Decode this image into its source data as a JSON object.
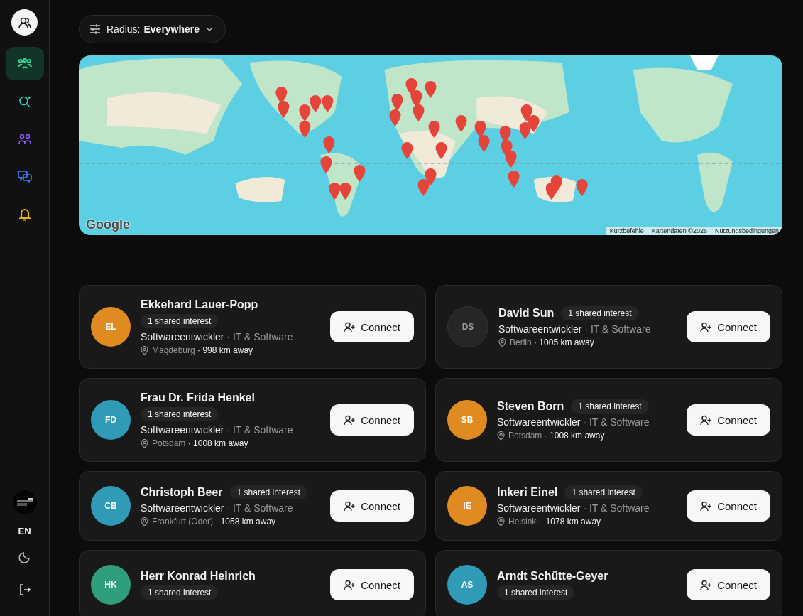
{
  "sidebar": {
    "items": [
      {
        "kind": "people",
        "selected": true,
        "color": "#34d399"
      },
      {
        "kind": "search",
        "selected": false,
        "color": "#2dd4bf"
      },
      {
        "kind": "group",
        "selected": false,
        "color": "#8b5cf6"
      },
      {
        "kind": "chat",
        "selected": false,
        "color": "#3b82f6"
      },
      {
        "kind": "bell",
        "selected": false,
        "color": "#eab308"
      }
    ],
    "language": "EN"
  },
  "filter": {
    "label": "Radius:",
    "value": "Everywhere"
  },
  "map": {
    "kind": "picture",
    "logo": "Google",
    "attribution": [
      "Kurzbefehle",
      "Kartendaten ©2026",
      "Nutzungsbedingungen"
    ]
  },
  "people": [
    {
      "initials": "EL",
      "color": "#e08b22",
      "name": "Ekkehard Lauer-Popp",
      "kind": "stacked",
      "badge": "1 shared interest",
      "role": "Softwareentwickler",
      "field": "· IT & Software",
      "city": "Magdeburg",
      "distance": "· 998 km away",
      "button": "Connect"
    },
    {
      "initials": "DS",
      "color": "#262626",
      "name": "David Sun",
      "kind": "inline",
      "badge": "1 shared interest",
      "role": "Softwareentwickler",
      "field": "· IT & Software",
      "city": "Berlin",
      "distance": "· 1005 km away",
      "button": "Connect"
    },
    {
      "initials": "FD",
      "color": "#2f9bb7",
      "name": "Frau Dr. Frida Henkel",
      "kind": "stacked",
      "badge": "1 shared interest",
      "role": "Softwareentwickler",
      "field": "· IT & Software",
      "city": "Potsdam",
      "distance": "· 1008 km away",
      "button": "Connect"
    },
    {
      "initials": "SB",
      "color": "#e08b22",
      "name": "Steven Born",
      "kind": "inline",
      "badge": "1 shared interest",
      "role": "Softwareentwickler",
      "field": "· IT & Software",
      "city": "Potsdam",
      "distance": "· 1008 km away",
      "button": "Connect"
    },
    {
      "initials": "CB",
      "color": "#2f9bb7",
      "name": "Christoph Beer",
      "kind": "inline",
      "badge": "1 shared interest",
      "role": "Softwareentwickler",
      "field": "· IT & Software",
      "city": "Frankfurt (Oder)",
      "distance": "· 1058 km away",
      "button": "Connect"
    },
    {
      "initials": "IE",
      "color": "#e08b22",
      "name": "Inkeri Einel",
      "kind": "inline",
      "badge": "1 shared interest",
      "role": "Softwareentwickler",
      "field": "· IT & Software",
      "city": "Helsinki",
      "distance": "· 1078 km away",
      "button": "Connect"
    },
    {
      "initials": "HK",
      "color": "#2f9e7c",
      "name": "Herr Konrad Heinrich",
      "kind": "stacked",
      "badge": "1 shared interest",
      "button": "Connect"
    },
    {
      "initials": "AS",
      "color": "#2f9bb7",
      "name": "Arndt Schütte-Geyer",
      "kind": "stacked",
      "badge": "1 shared interest",
      "button": "Connect"
    }
  ]
}
